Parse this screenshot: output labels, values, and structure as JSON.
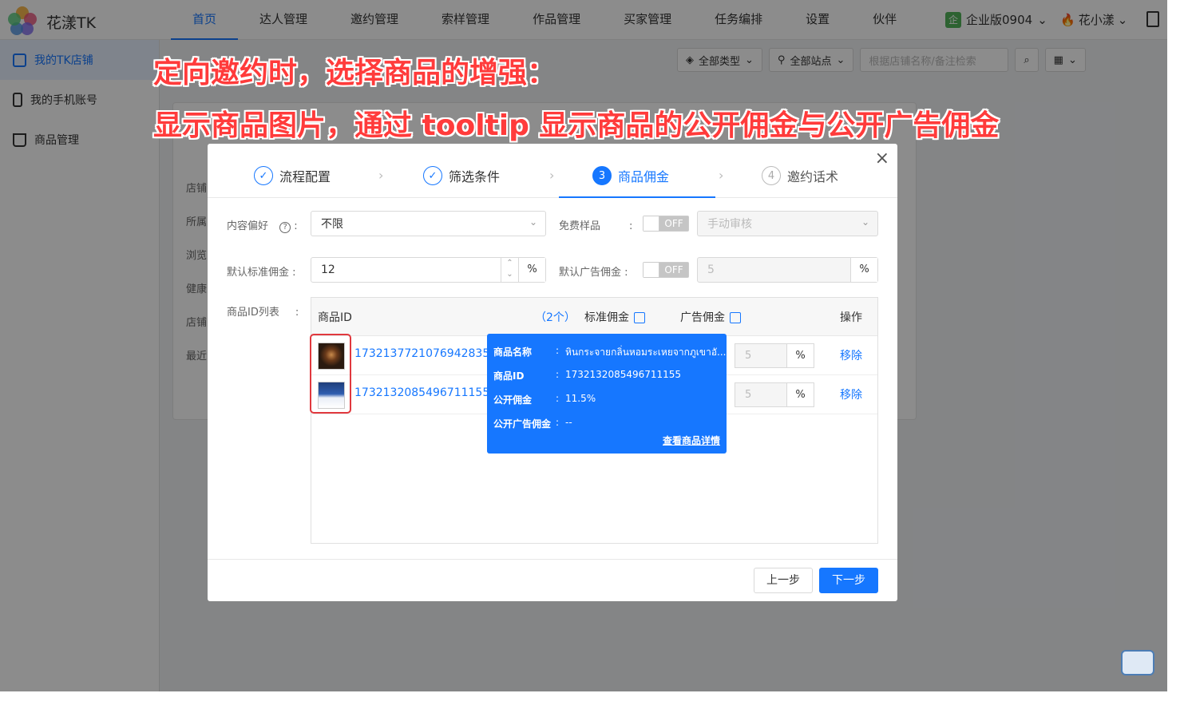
{
  "header": {
    "brand": "花漾TK",
    "nav": [
      "首页",
      "达人管理",
      "邀约管理",
      "索样管理",
      "作品管理",
      "买家管理",
      "任务编排",
      "设置",
      "伙伴"
    ],
    "edition_badge": "企",
    "edition": "企业版0904",
    "user": "花小漾"
  },
  "sidebar": {
    "items": [
      {
        "label": "我的TK店铺"
      },
      {
        "label": "我的手机账号"
      },
      {
        "label": "商品管理"
      }
    ]
  },
  "filters": {
    "type": "全部类型",
    "site": "全部站点",
    "search_placeholder": "根据店铺名称/备注检索"
  },
  "background_labels": [
    "店铺",
    "所属",
    "浏览",
    "健康",
    "店铺",
    "最近"
  ],
  "annotation": {
    "line1": "定向邀约时，选择商品的增强：",
    "line2": "显示商品图片，通过 tooltip 显示商品的公开佣金与公开广告佣金"
  },
  "modal": {
    "close": "×",
    "steps": [
      {
        "num": "✓",
        "label": "流程配置"
      },
      {
        "num": "✓",
        "label": "筛选条件"
      },
      {
        "num": "3",
        "label": "商品佣金"
      },
      {
        "num": "4",
        "label": "邀约话术"
      }
    ],
    "content_pref_label": "内容偏好",
    "content_pref_value": "不限",
    "free_sample_label": "免费样品",
    "free_sample_toggle": "OFF",
    "free_sample_mode": "手动审核",
    "default_std_label": "默认标准佣金",
    "default_std_value": "12",
    "percent": "%",
    "default_ad_label": "默认广告佣金",
    "default_ad_toggle": "OFF",
    "default_ad_value": "5",
    "list_label": "商品ID列表",
    "table": {
      "col_id": "商品ID",
      "count": "（2个）",
      "col_std": "标准佣金",
      "col_ad": "广告佣金",
      "col_op": "操作",
      "rows": [
        {
          "id": "1732137721076942835",
          "ad": "5",
          "op": "移除"
        },
        {
          "id": "1732132085496711155",
          "ad": "5",
          "op": "移除"
        }
      ]
    },
    "tooltip": {
      "name_key": "商品名称",
      "name_val": "หินกระจายกลิ่นหอมระเหยจากภูเขาอั...",
      "id_key": "商品ID",
      "id_val": "1732132085496711155",
      "pub_key": "公开佣金",
      "pub_val": "11.5%",
      "ad_key": "公开广告佣金",
      "ad_val": "--",
      "link": "查看商品详情",
      "sep": ":"
    },
    "prev": "上一步",
    "next": "下一步"
  }
}
